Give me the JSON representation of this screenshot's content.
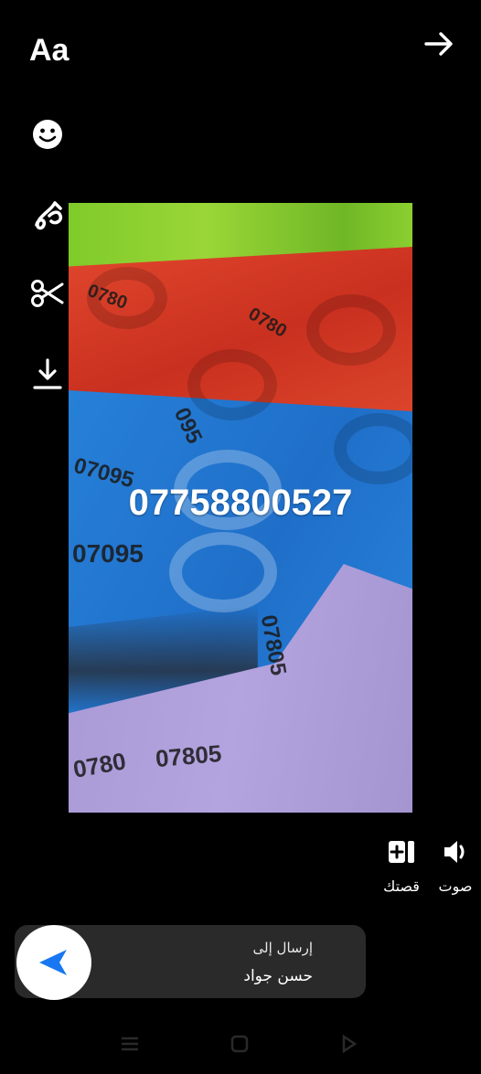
{
  "toolbar": {
    "text_tool_label": "Aa"
  },
  "photo": {
    "overlay_text": "07758800527",
    "ring_labels": [
      "07095",
      "095",
      "0780",
      "07805",
      "0780",
      "0780",
      "07805",
      "07095"
    ]
  },
  "actions": {
    "sound_label": "صوت",
    "story_label": "قصتك"
  },
  "send": {
    "label": "إرسال إلى",
    "recipient": "حسن جواد"
  },
  "colors": {
    "accent": "#1877f2",
    "background": "#000000",
    "send_bar": "#2a2a2a"
  }
}
